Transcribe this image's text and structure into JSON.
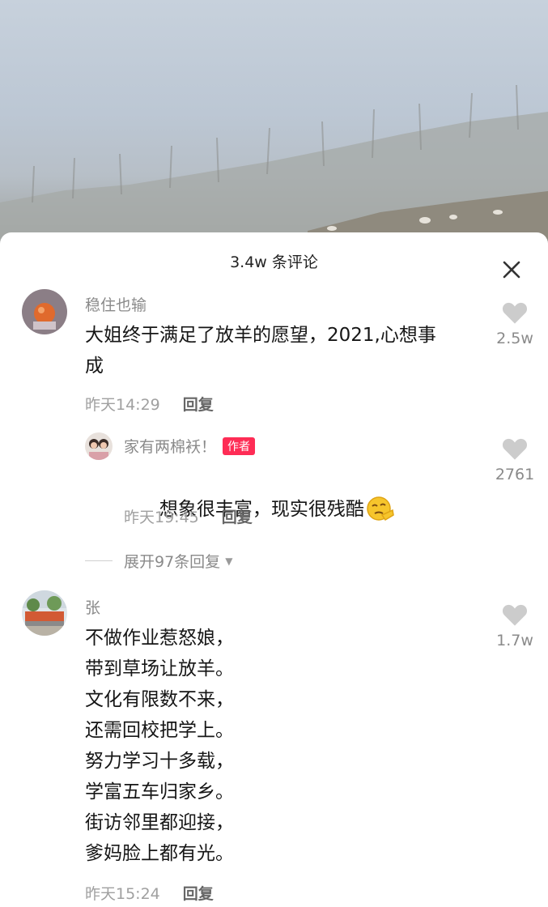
{
  "header": {
    "comment_count": "3.4w 条评论",
    "close_icon": "close-icon"
  },
  "comments": [
    {
      "username": "稳住也输",
      "text": "大姐终于满足了放羊的愿望，2021,心想事\n成",
      "time": "昨天14:29",
      "reply_label": "回复",
      "likes": "2.5w"
    },
    {
      "username": "家有两棉袄！",
      "badge": "作者",
      "text": "想象很丰富，现实很残酷",
      "emoji": "thinking-face-emoji",
      "time": "昨天19:45",
      "reply_label": "回复",
      "likes": "2761"
    },
    {
      "username": "张",
      "text": "不做作业惹怒娘，\n带到草场让放羊。\n文化有限数不来，\n还需回校把学上。\n努力学习十多载，\n学富五车归家乡。\n街访邻里都迎接，\n爹妈脸上都有光。",
      "time": "昨天15:24",
      "reply_label": "回复",
      "likes": "1.7w"
    }
  ],
  "expand_replies": "展开97条回复",
  "colors": {
    "badge": "#fe2c55",
    "heart": "#cccccc"
  }
}
